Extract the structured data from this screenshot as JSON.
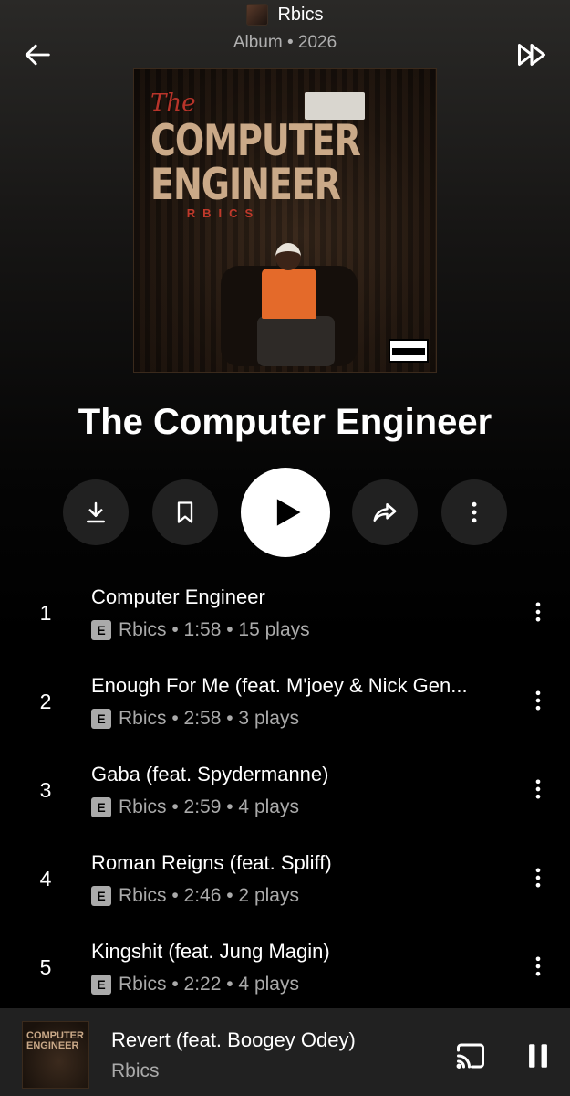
{
  "header": {
    "artist_name": "Rbics",
    "subtitle": "Album • 2026"
  },
  "album": {
    "title": "The Computer Engineer",
    "art_text": {
      "the": "The",
      "line1": "COMPUTER",
      "line2": "ENGINEER",
      "brand": "RBICS"
    }
  },
  "actions": {
    "download_icon": "download-icon",
    "save_icon": "bookmark-icon",
    "play_icon": "play-icon",
    "share_icon": "share-icon",
    "more_icon": "more-vertical-icon"
  },
  "tracks": [
    {
      "num": "1",
      "title": "Computer Engineer",
      "explicit": "E",
      "meta": "Rbics • 1:58 • 15 plays"
    },
    {
      "num": "2",
      "title": "Enough For Me (feat. M'joey & Nick Gen...",
      "explicit": "E",
      "meta": "Rbics • 2:58 • 3 plays"
    },
    {
      "num": "3",
      "title": "Gaba (feat. Spydermanne)",
      "explicit": "E",
      "meta": "Rbics • 2:59 • 4 plays"
    },
    {
      "num": "4",
      "title": "Roman Reigns (feat. Spliff)",
      "explicit": "E",
      "meta": "Rbics • 2:46 • 2 plays"
    },
    {
      "num": "5",
      "title": "Kingshit (feat. Jung Magin)",
      "explicit": "E",
      "meta": "Rbics • 2:22 • 4 plays"
    }
  ],
  "now_playing": {
    "title": "Revert (feat. Boogey Odey)",
    "artist": "Rbics",
    "thumb_text": "COMPUTER ENGINEER"
  },
  "colors": {
    "background": "#000000",
    "surface": "#212121",
    "secondary_text": "#aaaaaa",
    "accent_orange": "#e46a2a"
  }
}
